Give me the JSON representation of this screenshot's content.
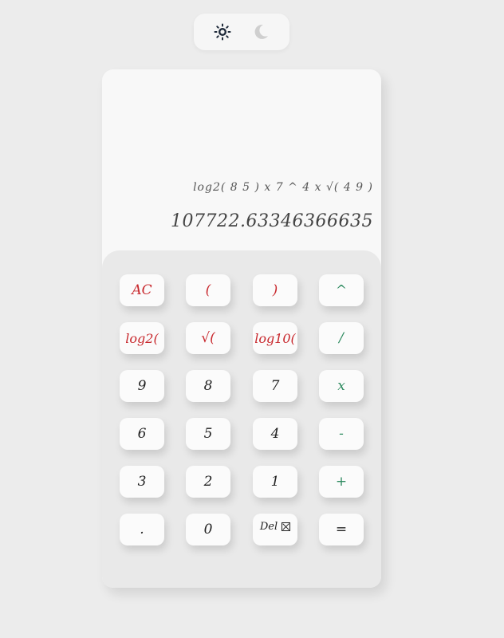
{
  "theme": {
    "light_icon": "sun-icon",
    "dark_icon": "moon-icon"
  },
  "display": {
    "expression": "log2( 8 5 ) x 7 ^ 4 x √( 4 9 )",
    "result": "107722.63346366635"
  },
  "keys": [
    {
      "label": "AC",
      "color": "red"
    },
    {
      "label": "(",
      "color": "red"
    },
    {
      "label": ")",
      "color": "red"
    },
    {
      "label": "^",
      "color": "green"
    },
    {
      "label": "log2(",
      "color": "red"
    },
    {
      "label": "√(",
      "color": "red"
    },
    {
      "label": "log10(",
      "color": "red"
    },
    {
      "label": "/",
      "color": "green"
    },
    {
      "label": "9",
      "color": "dark"
    },
    {
      "label": "8",
      "color": "dark"
    },
    {
      "label": "7",
      "color": "dark"
    },
    {
      "label": "x",
      "color": "green"
    },
    {
      "label": "6",
      "color": "dark"
    },
    {
      "label": "5",
      "color": "dark"
    },
    {
      "label": "4",
      "color": "dark"
    },
    {
      "label": "-",
      "color": "green"
    },
    {
      "label": "3",
      "color": "dark"
    },
    {
      "label": "2",
      "color": "dark"
    },
    {
      "label": "1",
      "color": "dark"
    },
    {
      "label": "+",
      "color": "green"
    },
    {
      "label": ".",
      "color": "dark"
    },
    {
      "label": "0",
      "color": "dark"
    },
    {
      "label": "Del",
      "color": "dark",
      "icon": "backspace-x-icon"
    },
    {
      "label": "=",
      "color": "dark"
    }
  ],
  "colors": {
    "red": "#c8282d",
    "green": "#2d8a5f",
    "dark": "#222222",
    "background": "#ececec"
  }
}
